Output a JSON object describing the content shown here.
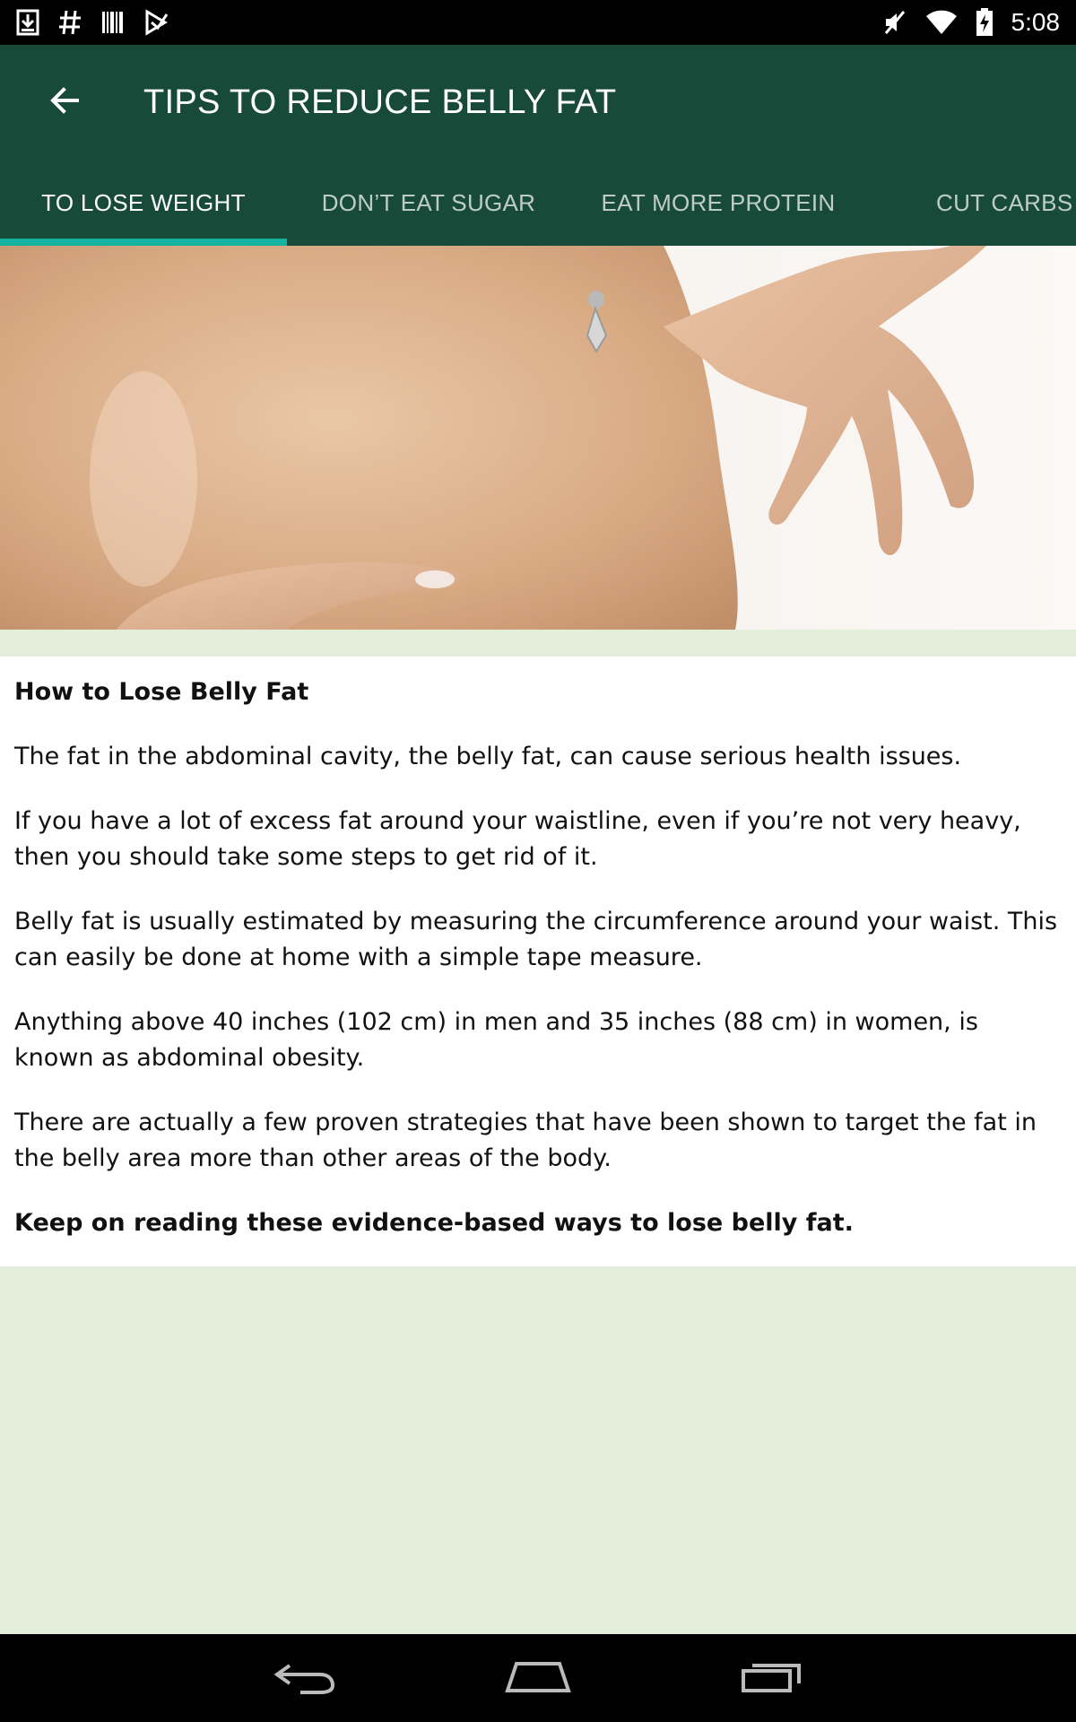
{
  "status_bar": {
    "time": "5:08",
    "left_icons": [
      "download-icon",
      "hash-icon",
      "barcode-icon",
      "play-store-icon"
    ],
    "right_icons": [
      "mute-icon",
      "wifi-icon",
      "battery-charging-icon"
    ]
  },
  "app_bar": {
    "title": "TIPS TO REDUCE BELLY FAT",
    "back_icon": "arrow-left-icon"
  },
  "tabs": [
    {
      "label": "TO LOSE WEIGHT",
      "active": true
    },
    {
      "label": "DON’T EAT SUGAR",
      "active": false
    },
    {
      "label": "EAT MORE PROTEIN",
      "active": false
    },
    {
      "label": "CUT CARBS",
      "active": false
    }
  ],
  "colors": {
    "toolbar": "#184a3a",
    "tab_indicator": "#14b3a0",
    "page_background": "#e3eedb"
  },
  "article": {
    "heading": "How to Lose Belly Fat",
    "paragraphs": [
      "The fat in the abdominal cavity, the belly fat, can cause serious health issues.",
      "If you have a lot of excess fat around your waistline, even if you’re not very heavy, then you should take some steps to get rid of it.",
      "Belly fat is usually estimated by measuring the circumference around your waist. This can easily be done at home with a simple tape measure.",
      "Anything above 40 inches (102 cm) in men and 35 inches (88 cm) in women, is known as abdominal obesity.",
      "There are actually a few proven strategies that have been shown to target the fat in the belly area more than other areas of the body."
    ],
    "closing": "Keep on reading these evidence-based ways to lose belly fat."
  },
  "nav_bar": {
    "icons": [
      "back-nav-icon",
      "home-nav-icon",
      "recents-nav-icon"
    ]
  }
}
